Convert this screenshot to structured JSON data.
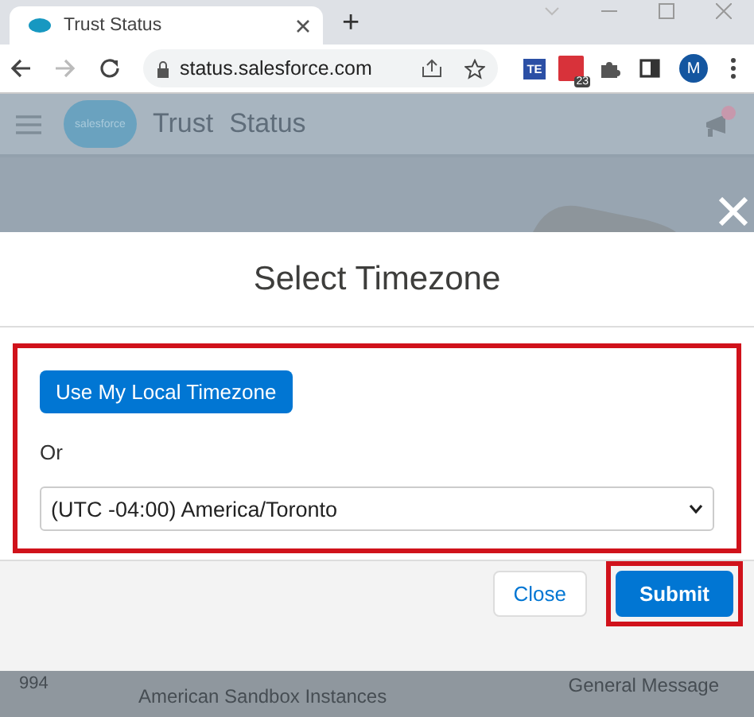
{
  "browser": {
    "tabs": [
      {
        "title": "Trust Status",
        "selected": true
      }
    ],
    "new_tab": "+",
    "address": "status.salesforce.com",
    "extensions": [
      {
        "kind": "text",
        "label": "TE"
      },
      {
        "kind": "calendar",
        "badge": "23"
      }
    ],
    "profile": "M"
  },
  "site": {
    "logo": "salesforce",
    "brand": [
      "Trust",
      "Status"
    ]
  },
  "modal": {
    "title": "Select Timezone",
    "local_button": "Use My Local Timezone",
    "or": "Or",
    "timezone": "(UTC -04:00) America/Toronto",
    "highlighted": true,
    "buttons": [
      {
        "label": "Close",
        "kind": "neutral",
        "highlighted": false
      },
      {
        "label": "Submit",
        "kind": "brand",
        "highlighted": true
      }
    ]
  },
  "background_row": {
    "column_1": "994",
    "column_2": "American Sandbox Instances",
    "column_3": "General Message"
  }
}
